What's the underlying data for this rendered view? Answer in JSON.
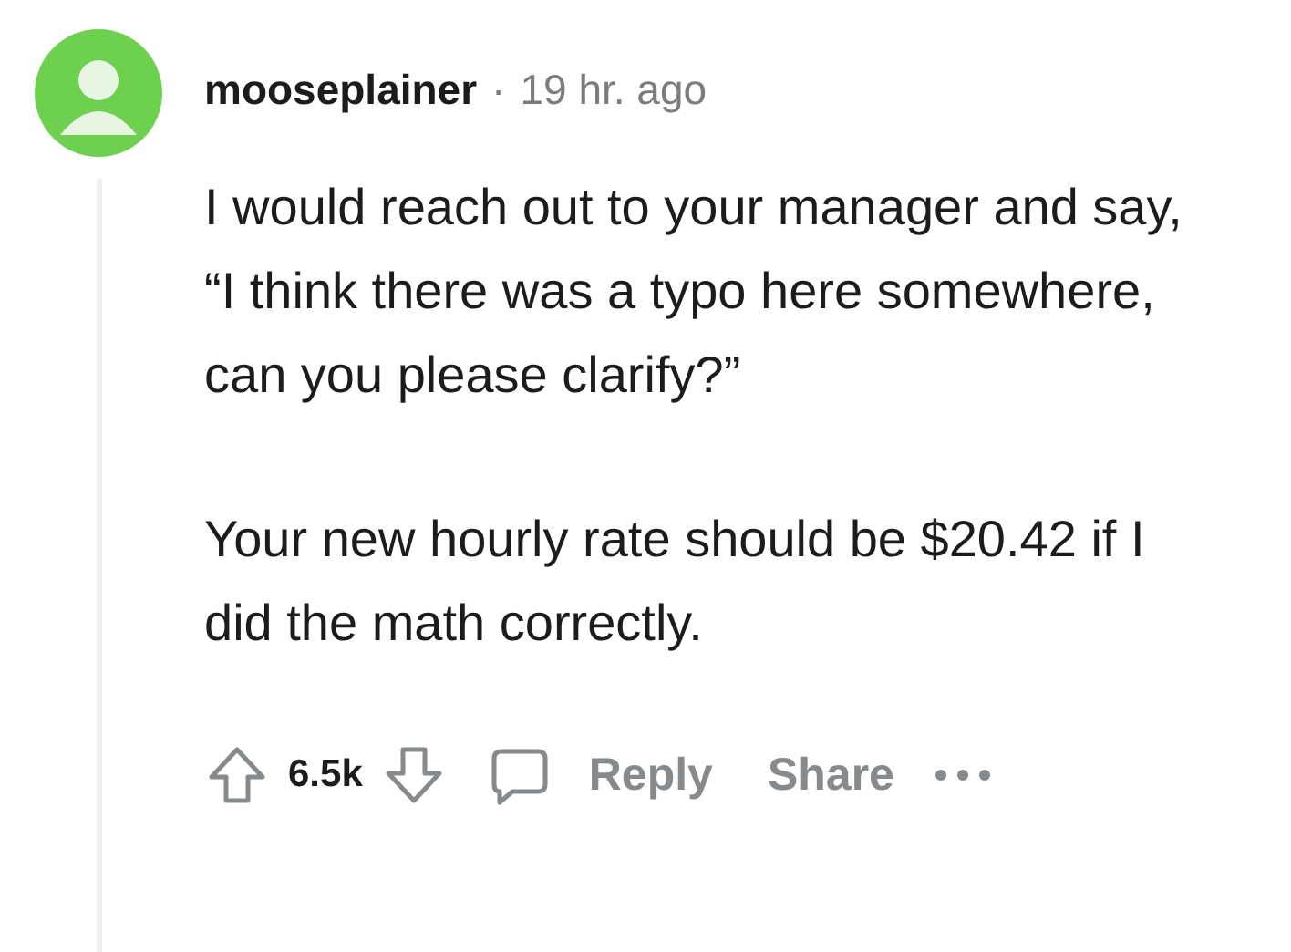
{
  "comment": {
    "author": "mooseplainer",
    "separator": "·",
    "time": "19 hr. ago",
    "paragraphs": [
      "I would reach out to your manager and say, “I think there was a typo here somewhere, can you please clarify?”",
      "Your new hourly rate should be $20.42 if I did the math correctly."
    ],
    "score": "6.5k",
    "actions": [
      "Reply",
      "Share"
    ]
  }
}
